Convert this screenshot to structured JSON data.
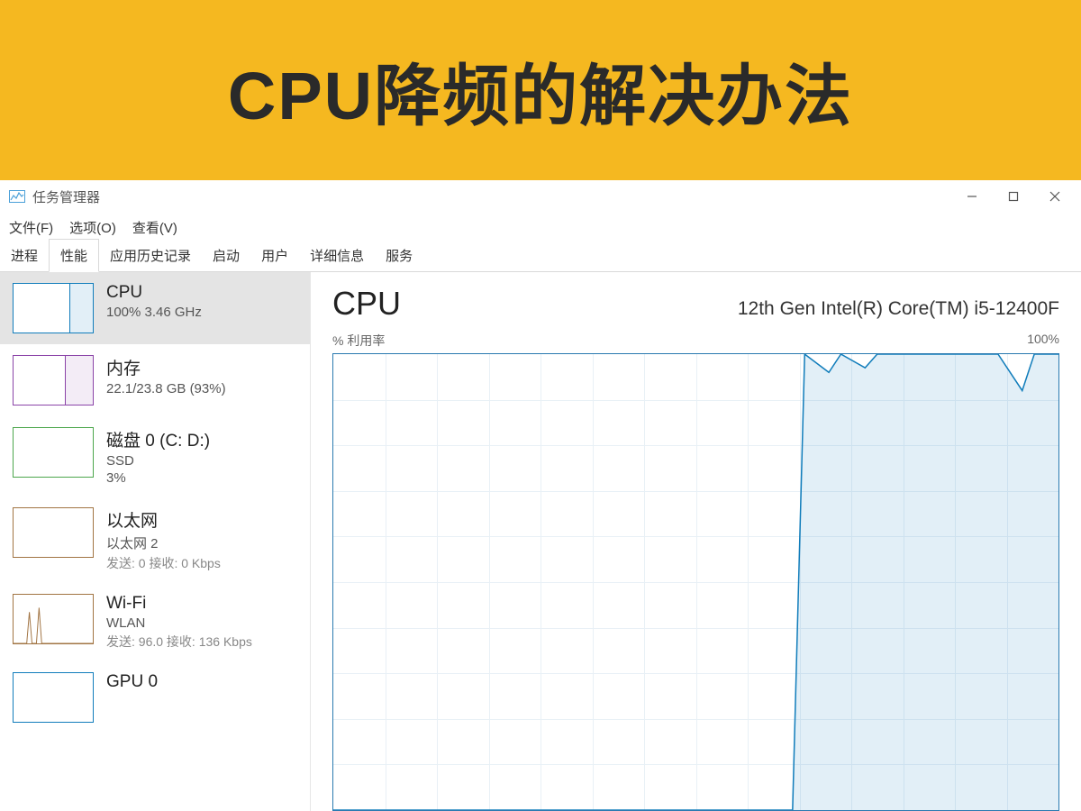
{
  "banner": {
    "title": "CPU降频的解决办法"
  },
  "window": {
    "title": "任务管理器",
    "menu": {
      "file": "文件(F)",
      "options": "选项(O)",
      "view": "查看(V)"
    },
    "tabs": {
      "processes": "进程",
      "performance": "性能",
      "app_history": "应用历史记录",
      "startup": "启动",
      "users": "用户",
      "details": "详细信息",
      "services": "服务"
    }
  },
  "sidebar": {
    "cpu": {
      "title": "CPU",
      "sub": "100%  3.46 GHz"
    },
    "mem": {
      "title": "内存",
      "sub": "22.1/23.8 GB (93%)"
    },
    "disk": {
      "title": "磁盘 0 (C: D:)",
      "sub": "SSD",
      "sub2": "3%"
    },
    "eth": {
      "title": "以太网",
      "sub": "以太网 2",
      "sub2": "发送: 0 接收: 0 Kbps"
    },
    "wifi": {
      "title": "Wi-Fi",
      "sub": "WLAN",
      "sub2": "发送: 96.0 接收: 136 Kbps"
    },
    "gpu": {
      "title": "GPU 0",
      "sub": ""
    }
  },
  "main": {
    "title": "CPU",
    "model": "12th Gen Intel(R) Core(TM) i5-12400F",
    "graph_left": "% 利用率",
    "graph_right": "100%"
  },
  "chart_data": {
    "type": "line",
    "title": "CPU % 利用率",
    "ylabel": "% 利用率",
    "ylim": [
      0,
      100
    ],
    "xlim": [
      0,
      60
    ],
    "x": [
      0,
      38,
      39,
      41,
      42,
      44,
      45,
      55,
      57,
      58,
      60
    ],
    "values": [
      0,
      0,
      100,
      96,
      100,
      97,
      100,
      100,
      92,
      100,
      100
    ]
  }
}
